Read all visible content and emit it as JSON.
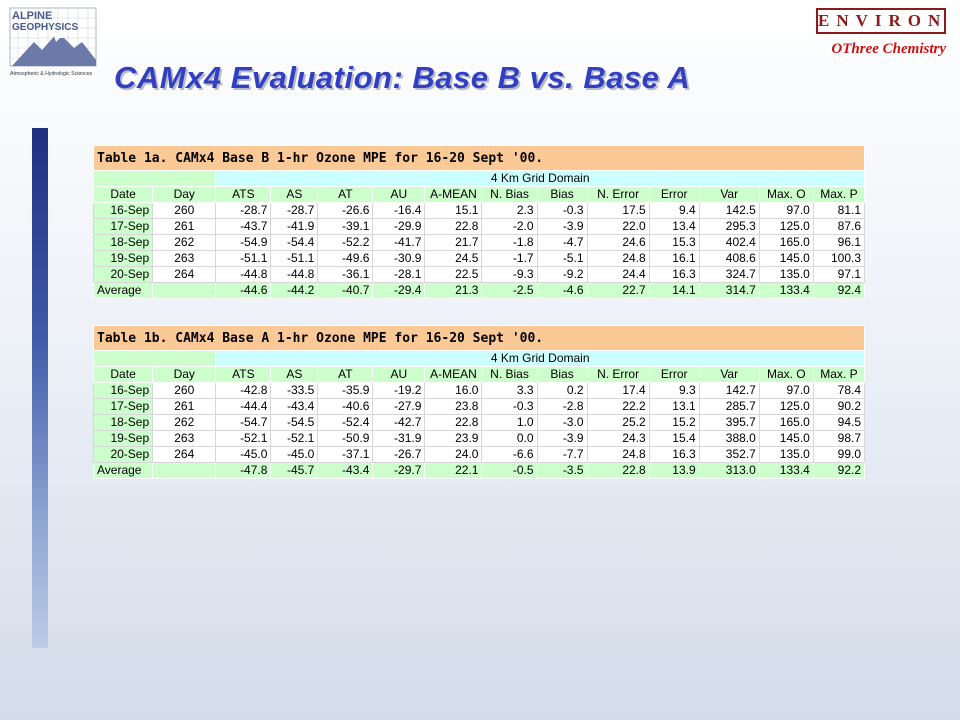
{
  "header": {
    "logo_line1": "ALPINE",
    "logo_line2": "GEOPHYSICS",
    "logo_tagline": "Atmospheric & Hydrologic Sciences",
    "brand": "ENVIRON",
    "subtitle": "OThree Chemistry",
    "title": "CAMx4 Evaluation: Base B vs. Base A"
  },
  "colors": {
    "title": "#3040c0",
    "brand": "#8b1a1a",
    "subtitle": "#cc1010",
    "caption_bg": "#fbc996",
    "header_bg": "#ccffcc",
    "domain_bg": "#ccffff"
  },
  "tables": [
    {
      "caption": "Table 1a.  CAMx4 Base B 1-hr Ozone MPE for 16-20 Sept '00.",
      "domain": "4 Km Grid Domain",
      "columns": [
        "Date",
        "Day",
        "ATS",
        "AS",
        "AT",
        "AU",
        "A-MEAN",
        "N. Bias",
        "Bias",
        "N. Error",
        "Error",
        "Var",
        "Max. O",
        "Max. P"
      ],
      "rows": [
        [
          "16-Sep",
          "260",
          "-28.7",
          "-28.7",
          "-26.6",
          "-16.4",
          "15.1",
          "2.3",
          "-0.3",
          "17.5",
          "9.4",
          "142.5",
          "97.0",
          "81.1"
        ],
        [
          "17-Sep",
          "261",
          "-43.7",
          "-41.9",
          "-39.1",
          "-29.9",
          "22.8",
          "-2.0",
          "-3.9",
          "22.0",
          "13.4",
          "295.3",
          "125.0",
          "87.6"
        ],
        [
          "18-Sep",
          "262",
          "-54.9",
          "-54.4",
          "-52.2",
          "-41.7",
          "21.7",
          "-1.8",
          "-4.7",
          "24.6",
          "15.3",
          "402.4",
          "165.0",
          "96.1"
        ],
        [
          "19-Sep",
          "263",
          "-51.1",
          "-51.1",
          "-49.6",
          "-30.9",
          "24.5",
          "-1.7",
          "-5.1",
          "24.8",
          "16.1",
          "408.6",
          "145.0",
          "100.3"
        ],
        [
          "20-Sep",
          "264",
          "-44.8",
          "-44.8",
          "-36.1",
          "-28.1",
          "22.5",
          "-9.3",
          "-9.2",
          "24.4",
          "16.3",
          "324.7",
          "135.0",
          "97.1"
        ]
      ],
      "average": [
        "Average",
        "",
        "-44.6",
        "-44.2",
        "-40.7",
        "-29.4",
        "21.3",
        "-2.5",
        "-4.6",
        "22.7",
        "14.1",
        "314.7",
        "133.4",
        "92.4"
      ]
    },
    {
      "caption": "Table 1b.  CAMx4 Base A 1-hr Ozone MPE for 16-20 Sept '00.",
      "domain": "4 Km Grid Domain",
      "columns": [
        "Date",
        "Day",
        "ATS",
        "AS",
        "AT",
        "AU",
        "A-MEAN",
        "N. Bias",
        "Bias",
        "N. Error",
        "Error",
        "Var",
        "Max. O",
        "Max. P"
      ],
      "rows": [
        [
          "16-Sep",
          "260",
          "-42.8",
          "-33.5",
          "-35.9",
          "-19.2",
          "16.0",
          "3.3",
          "0.2",
          "17.4",
          "9.3",
          "142.7",
          "97.0",
          "78.4"
        ],
        [
          "17-Sep",
          "261",
          "-44.4",
          "-43.4",
          "-40.6",
          "-27.9",
          "23.8",
          "-0.3",
          "-2.8",
          "22.2",
          "13.1",
          "285.7",
          "125.0",
          "90.2"
        ],
        [
          "18-Sep",
          "262",
          "-54.7",
          "-54.5",
          "-52.4",
          "-42.7",
          "22.8",
          "1.0",
          "-3.0",
          "25.2",
          "15.2",
          "395.7",
          "165.0",
          "94.5"
        ],
        [
          "19-Sep",
          "263",
          "-52.1",
          "-52.1",
          "-50.9",
          "-31.9",
          "23.9",
          "0.0",
          "-3.9",
          "24.3",
          "15.4",
          "388.0",
          "145.0",
          "98.7"
        ],
        [
          "20-Sep",
          "264",
          "-45.0",
          "-45.0",
          "-37.1",
          "-26.7",
          "24.0",
          "-6.6",
          "-7.7",
          "24.8",
          "16.3",
          "352.7",
          "135.0",
          "99.0"
        ]
      ],
      "average": [
        "Average",
        "",
        "-47.8",
        "-45.7",
        "-43.4",
        "-29.7",
        "22.1",
        "-0.5",
        "-3.5",
        "22.8",
        "13.9",
        "313.0",
        "133.4",
        "92.2"
      ]
    }
  ]
}
